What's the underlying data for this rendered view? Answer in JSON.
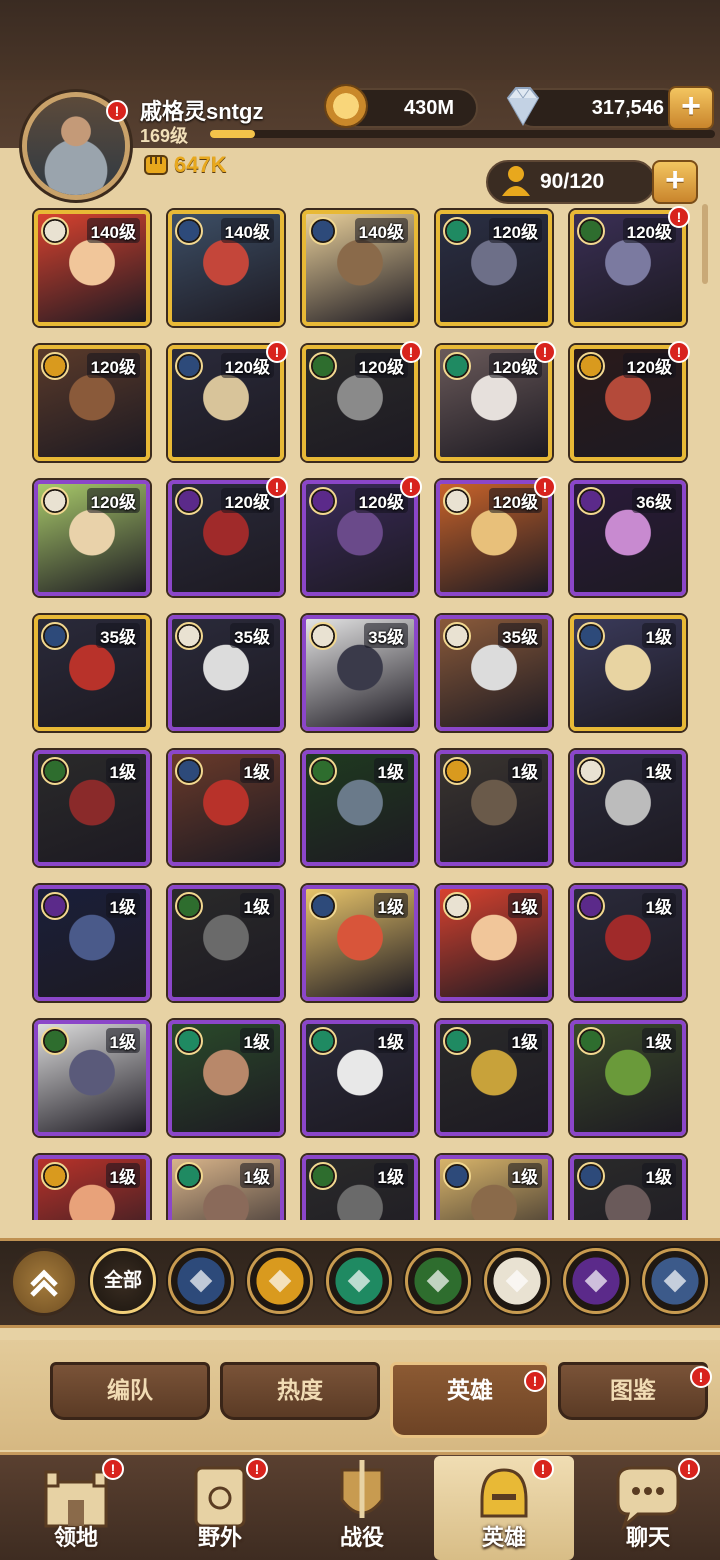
{
  "player": {
    "name": "戚格灵sntgz",
    "level": "169级",
    "xp_progress": 0.09,
    "power": "647K"
  },
  "resources": {
    "gold": "430M",
    "diamonds": "317,546",
    "hero_capacity": "90/120",
    "plus_label": "+"
  },
  "factions": {
    "all_label": "全部",
    "colors": {
      "lightbearer": "#2d4a7a",
      "mauler": "#d99a1e",
      "wilder": "#1f8a62",
      "graveborn": "#2e6d2e",
      "celestial": "#e9e2d2",
      "hypogean": "#5b2a8a",
      "dimensional": "#3c5a8a"
    }
  },
  "heroes": [
    {
      "level": "140级",
      "faction": "celestial",
      "rarity": "gold",
      "alert": false,
      "art": [
        "#d8422f",
        "#f1c69a"
      ]
    },
    {
      "level": "140级",
      "faction": "lightbearer",
      "rarity": "gold",
      "alert": false,
      "art": [
        "#3d4f66",
        "#c4463a"
      ]
    },
    {
      "level": "140级",
      "faction": "lightbearer",
      "rarity": "gold",
      "alert": false,
      "art": [
        "#e8cf9a",
        "#8a6a4a"
      ]
    },
    {
      "level": "120级",
      "faction": "wilder",
      "rarity": "gold",
      "alert": false,
      "art": [
        "#2a2f44",
        "#6d6f88"
      ]
    },
    {
      "level": "120级",
      "faction": "graveborn",
      "rarity": "gold",
      "alert": true,
      "art": [
        "#3a2f55",
        "#7b7aa0"
      ]
    },
    {
      "level": "120级",
      "faction": "mauler",
      "rarity": "gold",
      "alert": false,
      "art": [
        "#5a3a2a",
        "#8a5a3a"
      ]
    },
    {
      "level": "120级",
      "faction": "lightbearer",
      "rarity": "gold",
      "alert": true,
      "art": [
        "#2a2a3a",
        "#d8c49a"
      ]
    },
    {
      "level": "120级",
      "faction": "graveborn",
      "rarity": "gold",
      "alert": true,
      "art": [
        "#2a2a2a",
        "#8a8a8a"
      ]
    },
    {
      "level": "120级",
      "faction": "wilder",
      "rarity": "gold",
      "alert": true,
      "art": [
        "#6a5a5a",
        "#e6e0dc"
      ]
    },
    {
      "level": "120级",
      "faction": "mauler",
      "rarity": "gold",
      "alert": true,
      "art": [
        "#2a1a1a",
        "#b44a3a"
      ]
    },
    {
      "level": "120级",
      "faction": "celestial",
      "rarity": "purple",
      "alert": false,
      "art": [
        "#a8c96a",
        "#e9d2aa"
      ]
    },
    {
      "level": "120级",
      "faction": "hypogean",
      "rarity": "purple",
      "alert": true,
      "art": [
        "#2a2a3a",
        "#a02a2a"
      ]
    },
    {
      "level": "120级",
      "faction": "hypogean",
      "rarity": "purple",
      "alert": true,
      "art": [
        "#3a2a5a",
        "#6a4a8a"
      ]
    },
    {
      "level": "120级",
      "faction": "celestial",
      "rarity": "purple",
      "alert": true,
      "art": [
        "#c8632a",
        "#e8c07a"
      ]
    },
    {
      "level": "36级",
      "faction": "hypogean",
      "rarity": "purple",
      "alert": false,
      "art": [
        "#2a1a3a",
        "#c88ad0"
      ]
    },
    {
      "level": "35级",
      "faction": "lightbearer",
      "rarity": "gold",
      "alert": false,
      "art": [
        "#2a2a3a",
        "#b8322a"
      ]
    },
    {
      "level": "35级",
      "faction": "celestial",
      "rarity": "purple",
      "alert": false,
      "art": [
        "#2a2a3a",
        "#dcdcdc"
      ]
    },
    {
      "level": "35级",
      "faction": "celestial",
      "rarity": "purple",
      "alert": false,
      "art": [
        "#e4e4e4",
        "#3a3a4a"
      ]
    },
    {
      "level": "35级",
      "faction": "celestial",
      "rarity": "purple",
      "alert": false,
      "art": [
        "#8a5a3a",
        "#dcdcdc"
      ]
    },
    {
      "level": "1级",
      "faction": "lightbearer",
      "rarity": "gold",
      "alert": false,
      "art": [
        "#3a3a5a",
        "#e8d4a2"
      ]
    },
    {
      "level": "1级",
      "faction": "graveborn",
      "rarity": "purple",
      "alert": false,
      "art": [
        "#2a2a2a",
        "#8a2a2a"
      ]
    },
    {
      "level": "1级",
      "faction": "lightbearer",
      "rarity": "purple",
      "alert": false,
      "art": [
        "#6a3a2a",
        "#b8322a"
      ]
    },
    {
      "level": "1级",
      "faction": "graveborn",
      "rarity": "purple",
      "alert": false,
      "art": [
        "#1f3a1f",
        "#6a7a8a"
      ]
    },
    {
      "level": "1级",
      "faction": "mauler",
      "rarity": "purple",
      "alert": false,
      "art": [
        "#3a3530",
        "#6a5a4a"
      ]
    },
    {
      "level": "1级",
      "faction": "celestial",
      "rarity": "purple",
      "alert": false,
      "art": [
        "#2a2a3a",
        "#bcbcbc"
      ]
    },
    {
      "level": "1级",
      "faction": "hypogean",
      "rarity": "purple",
      "alert": false,
      "art": [
        "#1a1f3a",
        "#4a5a8a"
      ]
    },
    {
      "level": "1级",
      "faction": "graveborn",
      "rarity": "purple",
      "alert": false,
      "art": [
        "#2a2a2a",
        "#6a6a6a"
      ]
    },
    {
      "level": "1级",
      "faction": "lightbearer",
      "rarity": "purple",
      "alert": false,
      "art": [
        "#e8c46a",
        "#d8553a"
      ]
    },
    {
      "level": "1级",
      "faction": "celestial",
      "rarity": "purple",
      "alert": false,
      "art": [
        "#d8422f",
        "#f1c69a"
      ]
    },
    {
      "level": "1级",
      "faction": "hypogean",
      "rarity": "purple",
      "alert": false,
      "art": [
        "#2a2a3a",
        "#a02a2a"
      ]
    },
    {
      "level": "1级",
      "faction": "graveborn",
      "rarity": "purple",
      "alert": false,
      "art": [
        "#dcdcdc",
        "#5a5a7a"
      ]
    },
    {
      "level": "1级",
      "faction": "wilder",
      "rarity": "purple",
      "alert": false,
      "art": [
        "#2a4a2a",
        "#b8886a"
      ]
    },
    {
      "level": "1级",
      "faction": "wilder",
      "rarity": "purple",
      "alert": false,
      "art": [
        "#2a2a3a",
        "#e8e8e8"
      ]
    },
    {
      "level": "1级",
      "faction": "wilder",
      "rarity": "purple",
      "alert": false,
      "art": [
        "#2a2a2a",
        "#c8a23a"
      ]
    },
    {
      "level": "1级",
      "faction": "graveborn",
      "rarity": "purple",
      "alert": false,
      "art": [
        "#3a4a2a",
        "#6a9a3a"
      ]
    },
    {
      "level": "1级",
      "faction": "mauler",
      "rarity": "purple",
      "alert": false,
      "art": [
        "#b8322a",
        "#e8a27a"
      ]
    },
    {
      "level": "1级",
      "faction": "wilder",
      "rarity": "purple",
      "alert": false,
      "art": [
        "#d8b48a",
        "#8a6a5a"
      ]
    },
    {
      "level": "1级",
      "faction": "graveborn",
      "rarity": "purple",
      "alert": false,
      "art": [
        "#2a2a2a",
        "#6a6a6a"
      ]
    },
    {
      "level": "1级",
      "faction": "lightbearer",
      "rarity": "purple",
      "alert": false,
      "art": [
        "#d8b46a",
        "#8a6a4a"
      ]
    },
    {
      "level": "1级",
      "faction": "lightbearer",
      "rarity": "purple",
      "alert": false,
      "art": [
        "#2a2a2a",
        "#6a5a5a"
      ]
    }
  ],
  "subtabs": [
    {
      "label": "编队",
      "active": false
    },
    {
      "label": "热度",
      "active": false
    },
    {
      "label": "英雄",
      "active": true,
      "alert": true
    },
    {
      "label": "图鉴",
      "active": false,
      "alert": true
    }
  ],
  "nav": [
    {
      "label": "领地",
      "alert": true,
      "active": false
    },
    {
      "label": "野外",
      "alert": true,
      "active": false
    },
    {
      "label": "战役",
      "alert": false,
      "active": false
    },
    {
      "label": "英雄",
      "alert": true,
      "active": true
    },
    {
      "label": "聊天",
      "alert": true,
      "active": false
    }
  ]
}
